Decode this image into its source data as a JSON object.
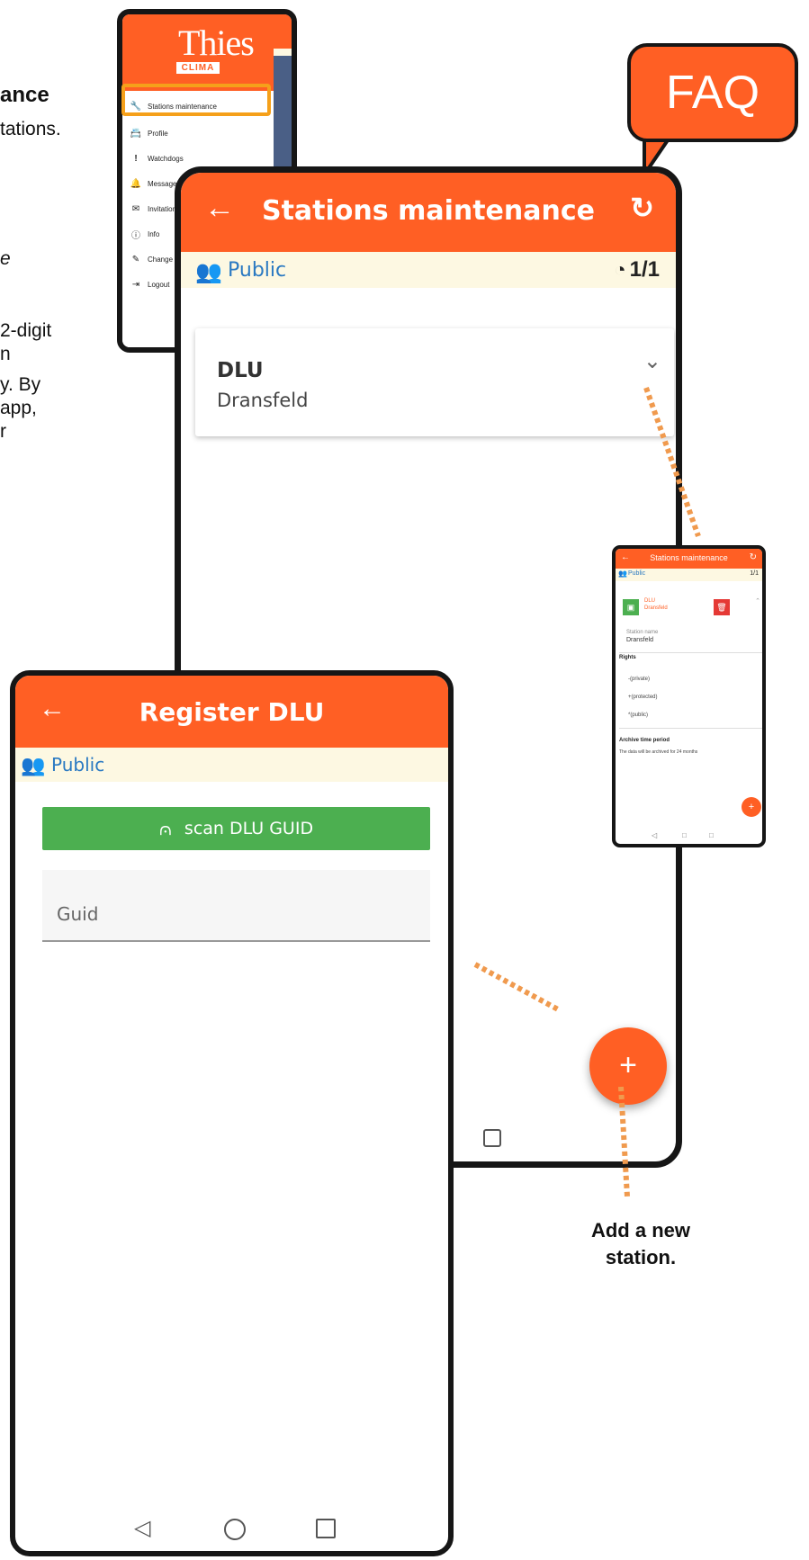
{
  "left_text": {
    "title_fragment": "ance",
    "line1": "tations.",
    "line2": "e",
    "line3": "2-digit",
    "line4": "n",
    "line5": "y. By",
    "line6": "app,",
    "line7": "r"
  },
  "menu": {
    "logo_main": "Thies",
    "logo_sub": "CLIMA",
    "items": [
      {
        "label": "Stations maintenance",
        "icon": "wrench-icon"
      },
      {
        "label": "Profile",
        "icon": "id-card-icon"
      },
      {
        "label": "Watchdogs",
        "icon": "exclamation-icon"
      },
      {
        "label": "Messages",
        "icon": "bell-icon"
      },
      {
        "label": "Invitation",
        "icon": "envelope-icon"
      },
      {
        "label": "Info",
        "icon": "info-icon"
      },
      {
        "label": "Change sty",
        "icon": "brush-icon"
      },
      {
        "label": "Logout",
        "icon": "logout-icon"
      }
    ]
  },
  "faq": {
    "label": "FAQ"
  },
  "stations": {
    "title": "Stations maintenance",
    "group": "Public",
    "counter": "1/1",
    "station_code": "DLU",
    "station_name": "Dransfeld",
    "fab_label": "+"
  },
  "detail": {
    "title": "Stations maintenance",
    "group": "Public",
    "counter": "1/1",
    "station_code": "DLU",
    "station_name": "Dransfeld",
    "field_label": "Station name",
    "field_value": "Dransfeld",
    "rights_label": "Rights",
    "rights": [
      "-(private)",
      "+(protected)",
      "*(public)"
    ],
    "archive_label": "Archive time period",
    "archive_text": "The data will be archived for 24 months"
  },
  "register": {
    "title": "Register DLU",
    "group": "Public",
    "scan_button": "scan DLU GUID",
    "guid_placeholder": "Guid"
  },
  "annotation": {
    "line1": "Add a new",
    "line2": "station."
  },
  "colors": {
    "accent": "#ff5f24",
    "cream": "#fdf8e2",
    "link": "#2a79c2",
    "success": "#4caf50",
    "danger": "#e53935",
    "highlight": "#f5a01a"
  }
}
